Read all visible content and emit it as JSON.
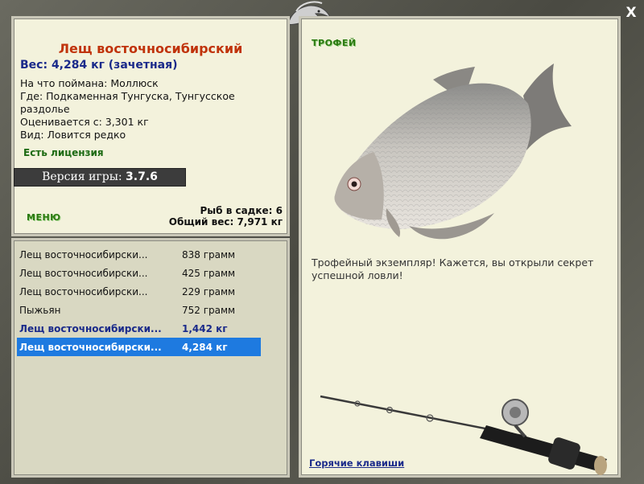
{
  "fish": {
    "title": "Лещ восточносибирский",
    "weight_line": "Вес: 4,284 кг (зачетная)",
    "caught_on": "На что поймана: Моллюск",
    "where": "Где: Подкаменная Тунгуска, Тунгусское раздолье",
    "valued": "Оценивается с: 3,301 кг",
    "kind": "Вид: Ловится редко"
  },
  "license": "Есть лицензия",
  "version": {
    "label": "Версия игры:",
    "number": "3.7.6"
  },
  "menu_label": "МЕНЮ",
  "stats": {
    "keepnet": "Рыб в садке: 6",
    "total": "Общий вес: 7,971 кг"
  },
  "catches": [
    {
      "name": "Лещ восточносибирски...",
      "weight": "838 грамм"
    },
    {
      "name": "Лещ восточносибирски...",
      "weight": "425 грамм"
    },
    {
      "name": "Лещ восточносибирски...",
      "weight": "229 грамм"
    },
    {
      "name": "Пыжьян",
      "weight": "752 грамм"
    },
    {
      "name": "Лещ восточносибирски...",
      "weight": "1,442 кг"
    },
    {
      "name": "Лещ восточносибирски...",
      "weight": "4,284 кг"
    }
  ],
  "trophy": {
    "label": "ТРОФЕЙ",
    "message": "Трофейный экземпляр! Кажется, вы открыли секрет успешной ловли!",
    "hotkeys": "Горячие клавиши"
  },
  "close_label": "X",
  "colors": {
    "title": "#c0330b",
    "trophy_text": "#1a2a8a",
    "menu_green": "#2b7a10",
    "selection": "#1e7ae0"
  }
}
